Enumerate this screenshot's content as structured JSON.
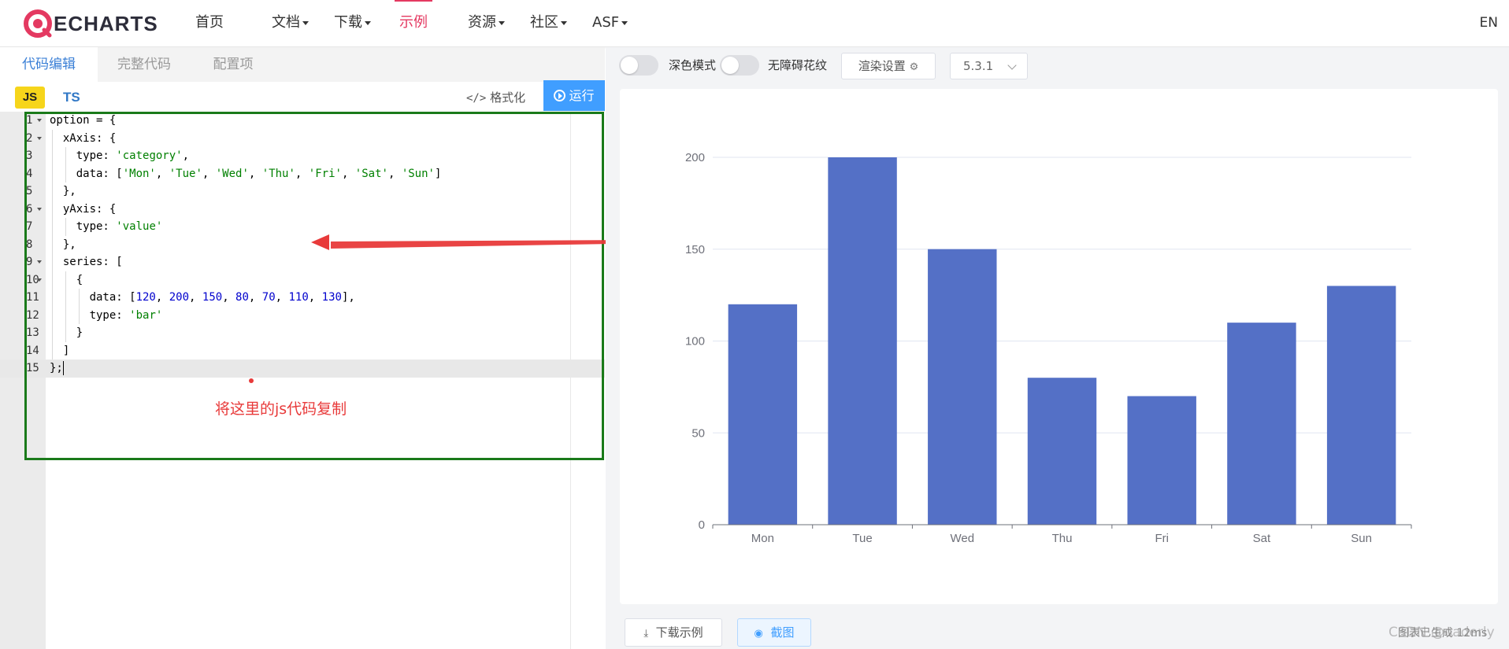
{
  "nav": {
    "logo_text": "ECHARTS",
    "items": [
      {
        "label": "首页",
        "dropdown": false
      },
      {
        "label": "文档",
        "dropdown": true
      },
      {
        "label": "下载",
        "dropdown": true
      },
      {
        "label": "示例",
        "dropdown": false,
        "active": true
      },
      {
        "label": "资源",
        "dropdown": true
      },
      {
        "label": "社区",
        "dropdown": true
      },
      {
        "label": "ASF",
        "dropdown": true
      }
    ],
    "lang": "EN",
    "accent_color": "#e43961"
  },
  "editor": {
    "tabs": [
      "代码编辑",
      "完整代码",
      "配置项"
    ],
    "active_tab": "代码编辑",
    "lang_js": "JS",
    "lang_ts": "TS",
    "format_label": "格式化",
    "run_label": "运行",
    "code_lines": [
      {
        "n": "1",
        "fold": true,
        "text": "option = {"
      },
      {
        "n": "2",
        "fold": true,
        "text": "  xAxis: {"
      },
      {
        "n": "3",
        "fold": false,
        "text": "    type: 'category',"
      },
      {
        "n": "4",
        "fold": false,
        "text": "    data: ['Mon', 'Tue', 'Wed', 'Thu', 'Fri', 'Sat', 'Sun']"
      },
      {
        "n": "5",
        "fold": false,
        "text": "  },"
      },
      {
        "n": "6",
        "fold": true,
        "text": "  yAxis: {"
      },
      {
        "n": "7",
        "fold": false,
        "text": "    type: 'value'"
      },
      {
        "n": "8",
        "fold": false,
        "text": "  },"
      },
      {
        "n": "9",
        "fold": true,
        "text": "  series: ["
      },
      {
        "n": "10",
        "fold": true,
        "text": "    {"
      },
      {
        "n": "11",
        "fold": false,
        "text": "      data: [120, 200, 150, 80, 70, 110, 130],"
      },
      {
        "n": "12",
        "fold": false,
        "text": "      type: 'bar'"
      },
      {
        "n": "13",
        "fold": false,
        "text": "    }"
      },
      {
        "n": "14",
        "fold": false,
        "text": "  ]"
      },
      {
        "n": "15",
        "fold": false,
        "text": "};"
      }
    ],
    "active_line": 15,
    "annotation_text": "将这里的js代码复制",
    "annotation_color": "#e83a3a",
    "box_color": "#1a7a1a"
  },
  "preview": {
    "dark_mode_label": "深色模式",
    "aria_label": "无障碍花纹",
    "render_settings_label": "渲染设置",
    "version": "5.3.1",
    "download_label": "下载示例",
    "screenshot_label": "截图",
    "status_text": "图表已生成 12ms",
    "watermark": "CSDN @oaderly"
  },
  "chart_data": {
    "type": "bar",
    "categories": [
      "Mon",
      "Tue",
      "Wed",
      "Thu",
      "Fri",
      "Sat",
      "Sun"
    ],
    "values": [
      120,
      200,
      150,
      80,
      70,
      110,
      130
    ],
    "ylim": [
      0,
      200
    ],
    "yticks": [
      0,
      50,
      100,
      150,
      200
    ],
    "grid": true,
    "bar_color": "#5470c6"
  }
}
